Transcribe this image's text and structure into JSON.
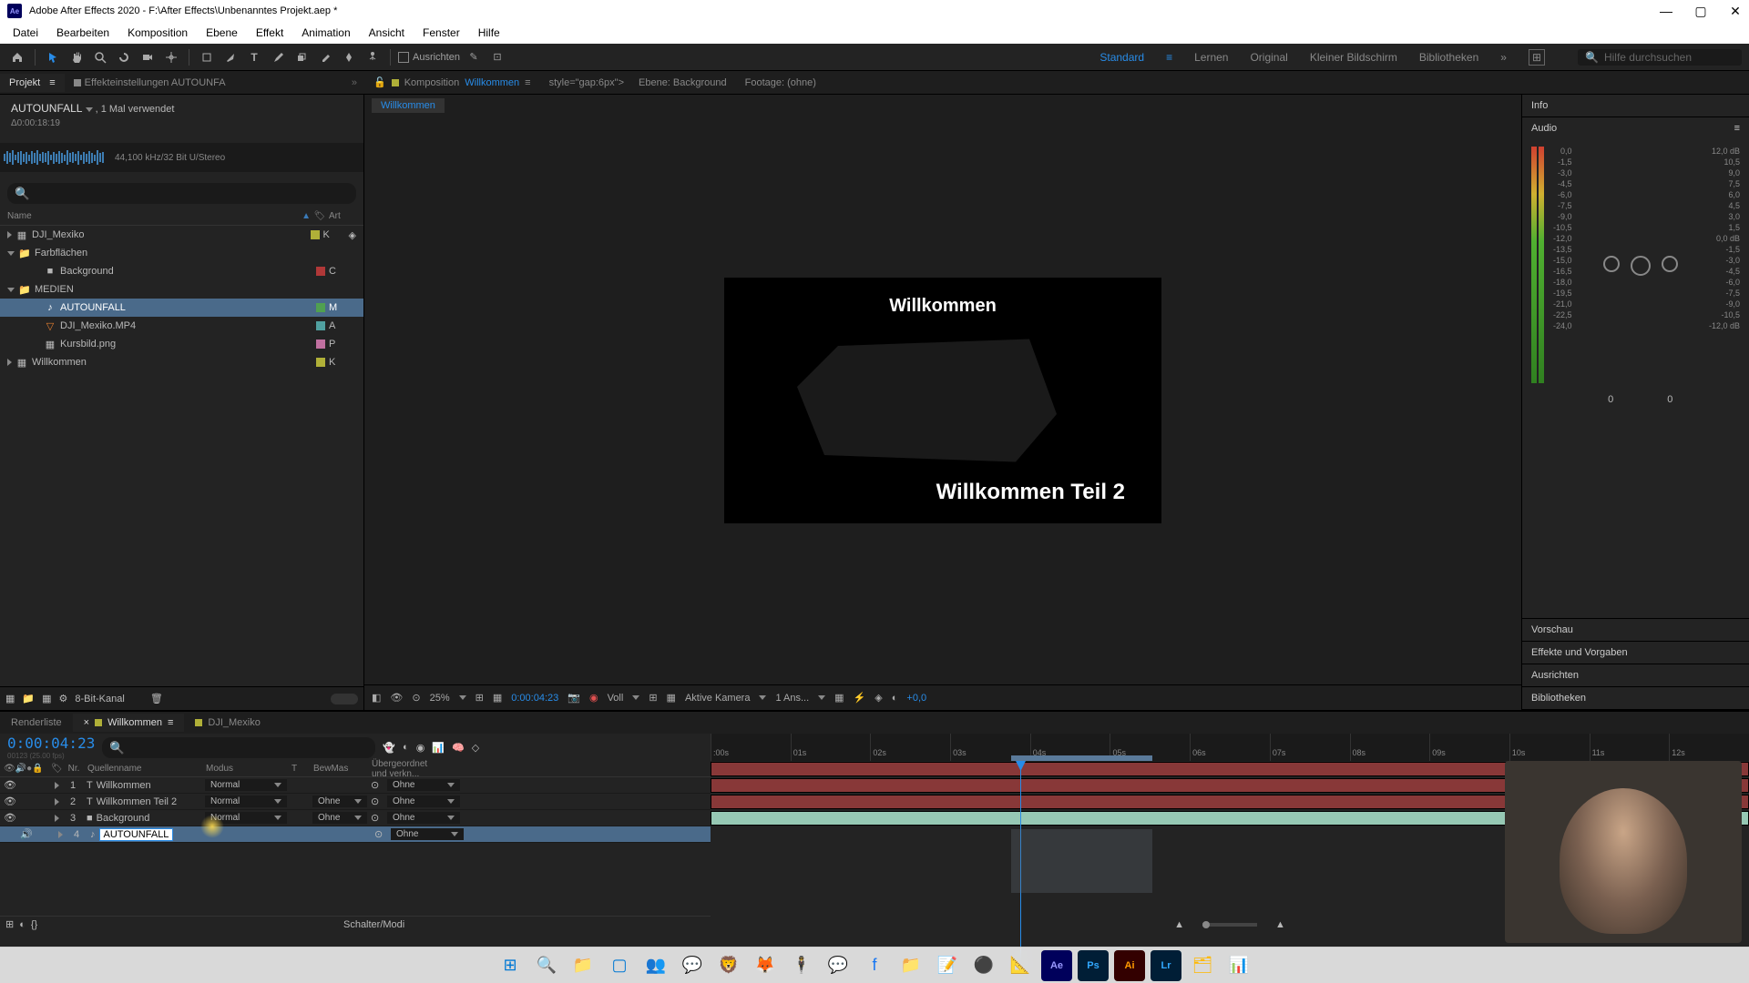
{
  "titlebar": {
    "text": "Adobe After Effects 2020 - F:\\After Effects\\Unbenanntes Projekt.aep *"
  },
  "menu": [
    "Datei",
    "Bearbeiten",
    "Komposition",
    "Ebene",
    "Effekt",
    "Animation",
    "Ansicht",
    "Fenster",
    "Hilfe"
  ],
  "toolbar": {
    "ausrichten": "Ausrichten",
    "workspaces": {
      "active": "Standard",
      "items": [
        "Lernen",
        "Original",
        "Kleiner Bildschirm",
        "Bibliotheken"
      ]
    },
    "search_placeholder": "Hilfe durchsuchen"
  },
  "left_tabs": {
    "projekt": "Projekt",
    "effekte": "Effekteinstellungen AUTOUNFA"
  },
  "comp_tabs": {
    "compPrefix": "Komposition",
    "compName": "Willkommen",
    "ebene": "Ebene: Background",
    "footage": "Footage: (ohne)"
  },
  "currentCompTab": "Willkommen",
  "project": {
    "assetName": "AUTOUNFALL",
    "assetUsed": ", 1 Mal verwendet",
    "assetDuration": "Δ0:00:18:19",
    "assetAudio": "44,100 kHz/32 Bit U/Stereo",
    "cols": {
      "name": "Name",
      "art": "Art"
    },
    "tree": [
      {
        "name": "DJI_Mexiko",
        "type": "comp",
        "chip": "chip-yellow",
        "ind": 0,
        "t": "K"
      },
      {
        "name": "Farbflächen",
        "type": "folder",
        "chip": "",
        "ind": 0,
        "t": ""
      },
      {
        "name": "Background",
        "type": "solid",
        "chip": "chip-red",
        "ind": 1,
        "t": "C"
      },
      {
        "name": "MEDIEN",
        "type": "folder",
        "chip": "",
        "ind": 0,
        "t": ""
      },
      {
        "name": "AUTOUNFALL",
        "type": "audio",
        "chip": "chip-green",
        "ind": 1,
        "sel": true,
        "t": "M"
      },
      {
        "name": "DJI_Mexiko.MP4",
        "type": "video",
        "chip": "chip-cyan",
        "ind": 1,
        "t": "A"
      },
      {
        "name": "Kursbild.png",
        "type": "image",
        "chip": "chip-pink",
        "ind": 1,
        "t": "P"
      },
      {
        "name": "Willkommen",
        "type": "comp",
        "chip": "chip-yellow",
        "ind": 0,
        "t": "K"
      }
    ],
    "footer": {
      "bpc": "8-Bit-Kanal"
    }
  },
  "viewer": {
    "text1": "Willkommen",
    "text2": "Willkommen Teil 2",
    "footer": {
      "zoom": "25%",
      "time": "0:00:04:23",
      "renderer": "Voll",
      "camera": "Aktive Kamera",
      "views": "1 Ans...",
      "exposure": "+0,0"
    }
  },
  "right": {
    "info": "Info",
    "audio": "Audio",
    "dbLeft": [
      "0,0",
      "-1,5",
      "-3,0",
      "-4,5",
      "-6,0",
      "-7,5",
      "-9,0",
      "-10,5",
      "-12,0",
      "-13,5",
      "-15,0",
      "-16,5",
      "-18,0",
      "-19,5",
      "-21,0",
      "-22,5",
      "-24,0"
    ],
    "dbRight": [
      "12,0 dB",
      "10,5",
      "9,0",
      "7,5",
      "6,0",
      "4,5",
      "3,0",
      "1,5",
      "0,0 dB",
      "-1,5",
      "-3,0",
      "-4,5",
      "-6,0",
      "-7,5",
      "-9,0",
      "-10,5",
      "-12,0 dB"
    ],
    "zeros": "0",
    "panels": [
      "Vorschau",
      "Effekte und Vorgaben",
      "Ausrichten",
      "Bibliotheken"
    ]
  },
  "timeline": {
    "tabs": {
      "renderliste": "Renderliste",
      "active": "Willkommen",
      "other": "DJI_Mexiko"
    },
    "timecode": "0:00:04:23",
    "fpsInfo": "00123 (25.00 fps)",
    "cols": {
      "nr": "Nr.",
      "quelle": "Quellenname",
      "modus": "Modus",
      "t": "T",
      "bew": "BewMas",
      "parent": "Übergeordnet und verkn..."
    },
    "ruler": [
      ":00s",
      "01s",
      "02s",
      "03s",
      "04s",
      "05s",
      "06s",
      "07s",
      "08s",
      "09s",
      "10s",
      "11s",
      "12s"
    ],
    "layers": [
      {
        "n": "1",
        "name": "Willkommen",
        "mode": "Normal",
        "track": "",
        "parent": "Ohne",
        "icon": "T",
        "chip": "chip-red"
      },
      {
        "n": "2",
        "name": "Willkommen Teil 2",
        "mode": "Normal",
        "track": "Ohne",
        "parent": "Ohne",
        "icon": "T",
        "chip": "chip-red"
      },
      {
        "n": "3",
        "name": "Background",
        "mode": "Normal",
        "track": "Ohne",
        "parent": "Ohne",
        "icon": "■",
        "chip": "chip-red"
      },
      {
        "n": "4",
        "name": "AUTOUNFALL",
        "mode": "",
        "track": "",
        "parent": "Ohne",
        "icon": "♪",
        "chip": "chip-cyan",
        "sel": true
      }
    ],
    "switchLabel": "Schalter/Modi"
  }
}
